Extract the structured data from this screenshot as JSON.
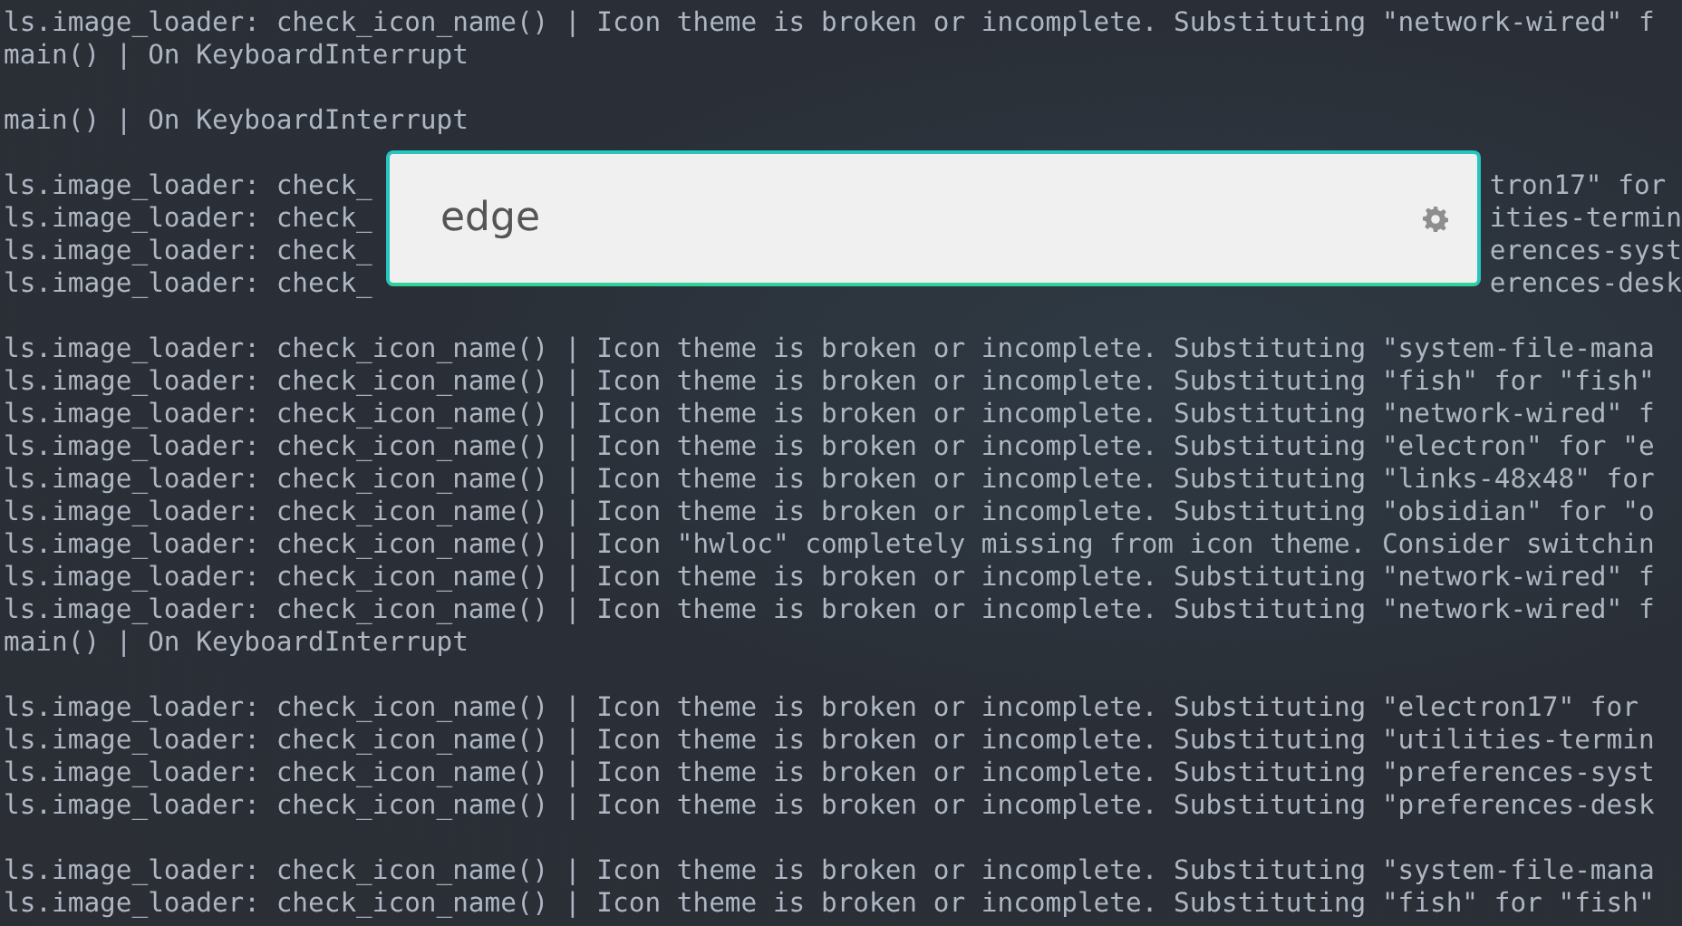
{
  "terminal": {
    "lines": [
      {
        "kind": "line",
        "text": "ls.image_loader: check_icon_name() | Icon theme is broken or incomplete. Substituting \"network-wired\" f"
      },
      {
        "kind": "line",
        "text": "main() | On KeyboardInterrupt"
      },
      {
        "kind": "blank"
      },
      {
        "kind": "line",
        "text": "main() | On KeyboardInterrupt"
      },
      {
        "kind": "blank"
      },
      {
        "kind": "split",
        "left": "ls.image_loader: check_",
        "right": "tron17\" for "
      },
      {
        "kind": "split",
        "left": "ls.image_loader: check_",
        "right": "ities-termin"
      },
      {
        "kind": "split",
        "left": "ls.image_loader: check_",
        "right": "erences-syst"
      },
      {
        "kind": "split",
        "left": "ls.image_loader: check_",
        "right": "erences-desk"
      },
      {
        "kind": "blank"
      },
      {
        "kind": "line",
        "text": "ls.image_loader: check_icon_name() | Icon theme is broken or incomplete. Substituting \"system-file-mana"
      },
      {
        "kind": "line",
        "text": "ls.image_loader: check_icon_name() | Icon theme is broken or incomplete. Substituting \"fish\" for \"fish\""
      },
      {
        "kind": "line",
        "text": "ls.image_loader: check_icon_name() | Icon theme is broken or incomplete. Substituting \"network-wired\" f"
      },
      {
        "kind": "line",
        "text": "ls.image_loader: check_icon_name() | Icon theme is broken or incomplete. Substituting \"electron\" for \"e"
      },
      {
        "kind": "line",
        "text": "ls.image_loader: check_icon_name() | Icon theme is broken or incomplete. Substituting \"links-48x48\" for"
      },
      {
        "kind": "line",
        "text": "ls.image_loader: check_icon_name() | Icon theme is broken or incomplete. Substituting \"obsidian\" for \"o"
      },
      {
        "kind": "line",
        "text": "ls.image_loader: check_icon_name() | Icon \"hwloc\" completely missing from icon theme. Consider switchin"
      },
      {
        "kind": "line",
        "text": "ls.image_loader: check_icon_name() | Icon theme is broken or incomplete. Substituting \"network-wired\" f"
      },
      {
        "kind": "line",
        "text": "ls.image_loader: check_icon_name() | Icon theme is broken or incomplete. Substituting \"network-wired\" f"
      },
      {
        "kind": "line",
        "text": "main() | On KeyboardInterrupt"
      },
      {
        "kind": "blank"
      },
      {
        "kind": "line",
        "text": "ls.image_loader: check_icon_name() | Icon theme is broken or incomplete. Substituting \"electron17\" for"
      },
      {
        "kind": "line",
        "text": "ls.image_loader: check_icon_name() | Icon theme is broken or incomplete. Substituting \"utilities-termin"
      },
      {
        "kind": "line",
        "text": "ls.image_loader: check_icon_name() | Icon theme is broken or incomplete. Substituting \"preferences-syst"
      },
      {
        "kind": "line",
        "text": "ls.image_loader: check_icon_name() | Icon theme is broken or incomplete. Substituting \"preferences-desk"
      },
      {
        "kind": "blank"
      },
      {
        "kind": "line",
        "text": "ls.image_loader: check_icon_name() | Icon theme is broken or incomplete. Substituting \"system-file-mana"
      },
      {
        "kind": "line",
        "text": "ls.image_loader: check_icon_name() | Icon theme is broken or incomplete. Substituting \"fish\" for \"fish\""
      }
    ]
  },
  "launcher": {
    "query": "edge"
  }
}
